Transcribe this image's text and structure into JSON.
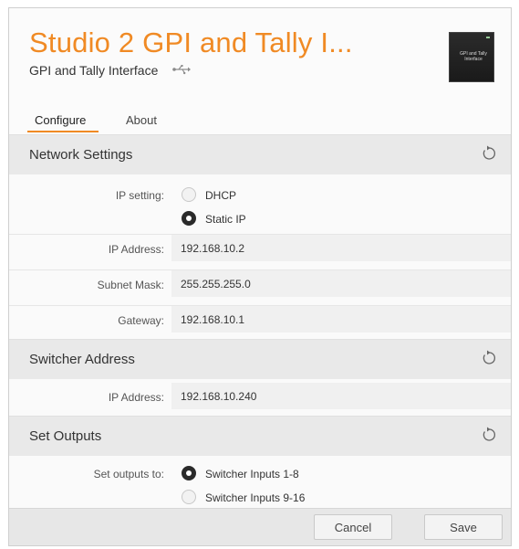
{
  "header": {
    "title": "Studio 2 GPI and Tally I...",
    "subtitle": "GPI and Tally Interface",
    "thumb_text": "GPI and Tally Interface"
  },
  "tabs": [
    {
      "label": "Configure",
      "active": true
    },
    {
      "label": "About",
      "active": false
    }
  ],
  "network_settings": {
    "heading": "Network Settings",
    "ip_setting_label": "IP setting:",
    "options": [
      "DHCP",
      "Static IP"
    ],
    "selected": "Static IP",
    "ip_address_label": "IP Address:",
    "ip_address": "192.168.10.2",
    "subnet_mask_label": "Subnet Mask:",
    "subnet_mask": "255.255.255.0",
    "gateway_label": "Gateway:",
    "gateway": "192.168.10.1"
  },
  "switcher_address": {
    "heading": "Switcher Address",
    "ip_address_label": "IP Address:",
    "ip_address": "192.168.10.240"
  },
  "set_outputs": {
    "heading": "Set Outputs",
    "label": "Set outputs to:",
    "options": [
      "Switcher Inputs 1-8",
      "Switcher Inputs 9-16"
    ],
    "selected": "Switcher Inputs 1-8"
  },
  "footer": {
    "cancel": "Cancel",
    "save": "Save"
  },
  "colors": {
    "accent": "#f08a24"
  }
}
